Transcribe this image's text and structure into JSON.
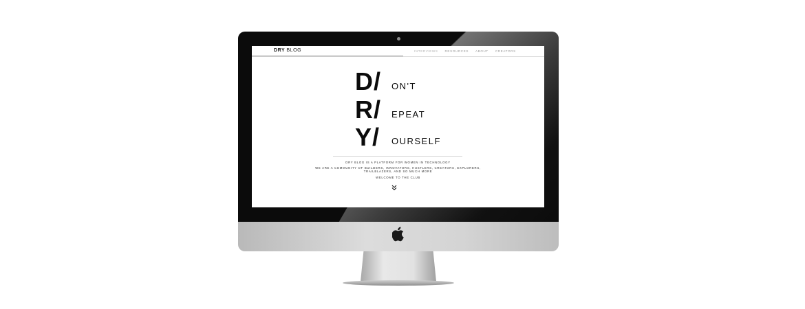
{
  "nav": {
    "brand_bold": "DRY",
    "brand_rest": "BLOG",
    "links": [
      "INTERVIEWS",
      "RESOURCES",
      "ABOUT",
      "CREATORS"
    ]
  },
  "hero": {
    "rows": [
      {
        "letter": "D/",
        "rest": "ON'T"
      },
      {
        "letter": "R/",
        "rest": "EPEAT"
      },
      {
        "letter": "Y/",
        "rest": "OURSELF"
      }
    ]
  },
  "tagline": {
    "line1": "DRY BLOG IS A PLATFORM FOR WOMEN IN TECHNOLOGY",
    "line2": "WE ARE A COMMUNITY OF BUILDERS, INNOVATORS, HUSTLERS, CREATORS, EXPLORERS,",
    "line3": "TRAILBLAZERS, AND SO MUCH MORE",
    "line4": "WELCOME TO THE CLUB"
  },
  "icons": {
    "scroll": "double-chevron-down-icon",
    "brand_logo": "apple-logo-icon"
  },
  "colors": {
    "text": "#0b0b0b",
    "nav_link": "#9c9c9c",
    "bezel": "#0b0b0b",
    "chin": "#d4d4d4"
  }
}
